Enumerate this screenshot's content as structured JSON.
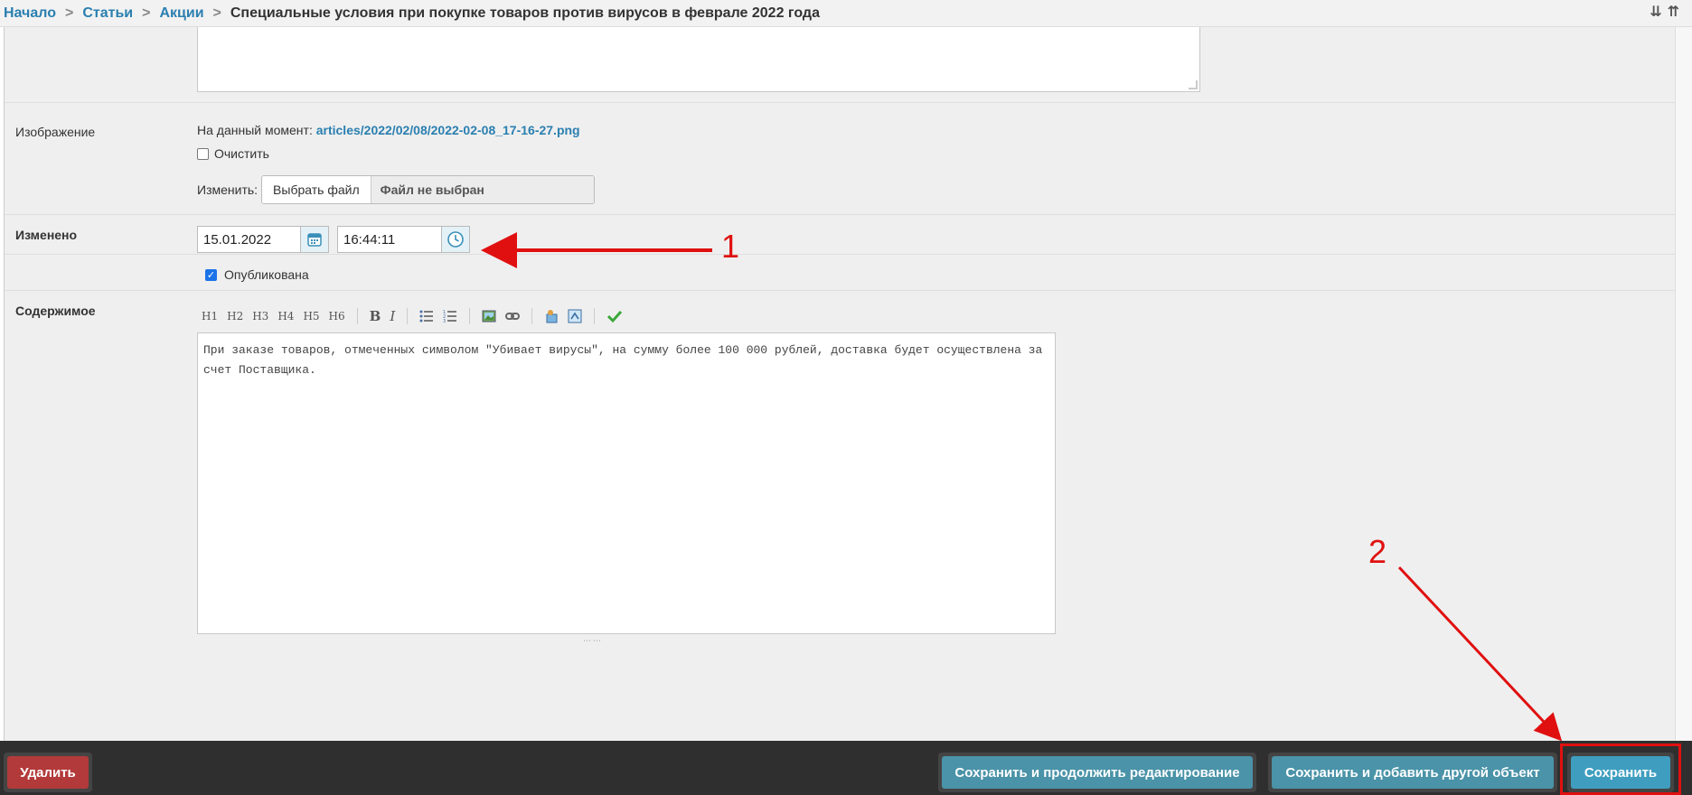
{
  "breadcrumb": {
    "items": [
      "Начало",
      "Статьи",
      "Акции"
    ],
    "current": "Специальные условия при покупке товаров против вирусов в феврале 2022 года"
  },
  "image_field": {
    "label": "Изображение",
    "current_prefix": "На данный момент:",
    "current_path": "articles/2022/02/08/2022-02-08_17-16-27.png",
    "clear_label": "Очистить",
    "change_label": "Изменить:",
    "choose_file": "Выбрать файл",
    "no_file": "Файл не выбран"
  },
  "modified_field": {
    "label": "Изменено",
    "date": "15.01.2022",
    "time": "16:44:11"
  },
  "published_field": {
    "label": "Опубликована",
    "checked": true
  },
  "content_field": {
    "label": "Содержимое",
    "toolbar": [
      "H1",
      "H2",
      "H3",
      "H4",
      "H5",
      "H6",
      "B",
      "I"
    ],
    "text": "При заказе товаров, отмеченных символом \"Убивает вирусы\", на сумму более 100 000 рублей, доставка будет осуществлена за счет Поставщика."
  },
  "footer": {
    "delete": "Удалить",
    "save_continue": "Сохранить и продолжить редактирование",
    "save_add": "Сохранить и добавить другой объект",
    "save": "Сохранить"
  },
  "annotations": {
    "one": "1",
    "two": "2"
  },
  "colors": {
    "link": "#2a7fb0",
    "annotation": "#e01010",
    "delete_button": "#b33a3a",
    "save_button": "#3f9ec0"
  }
}
